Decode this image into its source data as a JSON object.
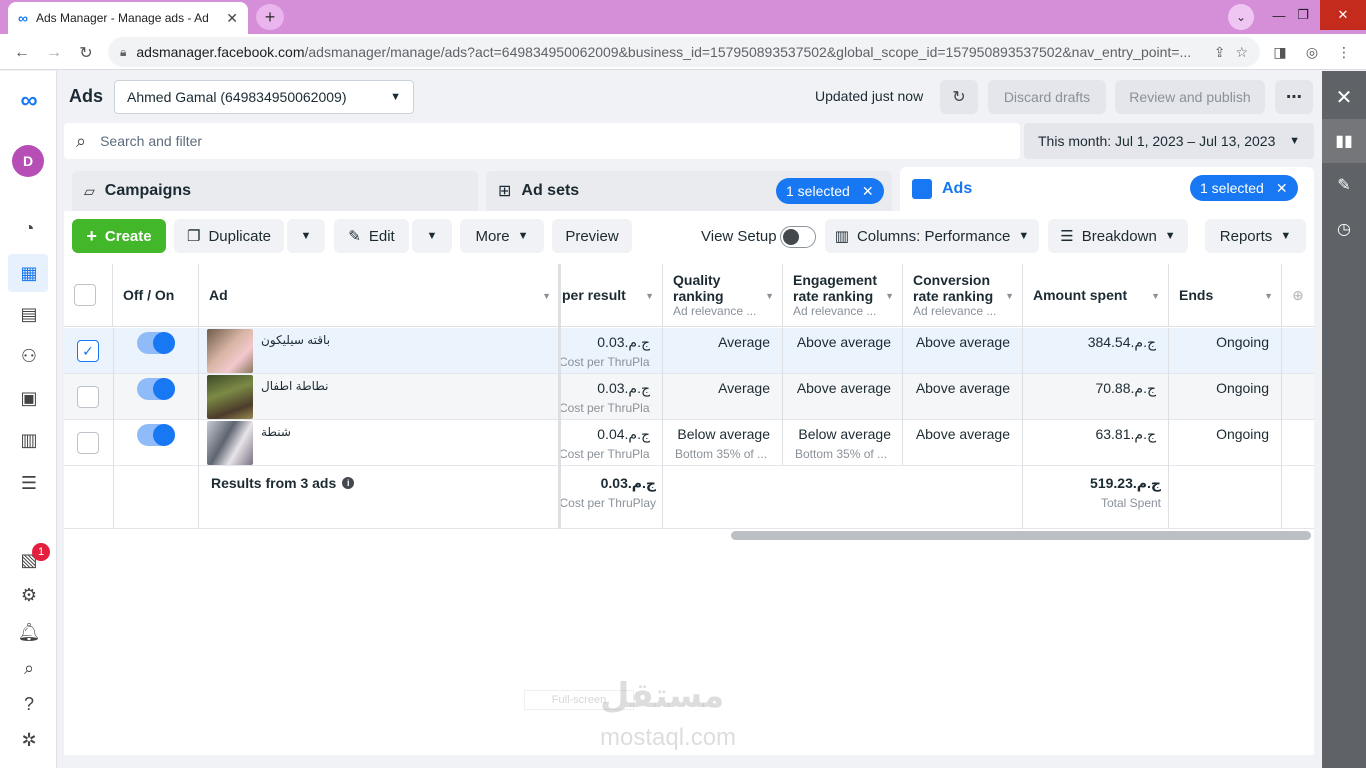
{
  "browser": {
    "tab_title": "Ads Manager - Manage ads - Ad",
    "url_domain": "adsmanager.facebook.com",
    "url_path": "/adsmanager/manage/ads?act=649834950062009&business_id=157950893537502&global_scope_id=157950893537502&nav_entry_point=..."
  },
  "header": {
    "title": "Ads",
    "account": "Ahmed Gamal (649834950062009)",
    "updated": "Updated just now",
    "discard": "Discard drafts",
    "review": "Review and publish"
  },
  "search": {
    "placeholder": "Search and filter"
  },
  "date_range": "This month: Jul 1, 2023 – Jul 13, 2023",
  "levels": {
    "campaigns": "Campaigns",
    "adsets": "Ad sets",
    "ads": "Ads",
    "selected": "1 selected"
  },
  "rail": {
    "avatar": "D",
    "notif_count": "1"
  },
  "toolbar": {
    "create": "Create",
    "duplicate": "Duplicate",
    "edit": "Edit",
    "more": "More",
    "preview": "Preview",
    "view_setup": "View Setup",
    "columns": "Columns: Performance",
    "breakdown": "Breakdown",
    "reports": "Reports"
  },
  "columns": {
    "onoff": "Off / On",
    "ad": "Ad",
    "cost": "per result",
    "quality": "Quality ranking",
    "quality_sub": "Ad relevance ...",
    "engagement": "Engagement rate ranking",
    "engagement_sub": "Ad relevance ...",
    "conversion": "Conversion rate ranking",
    "conversion_sub": "Ad relevance ...",
    "spent": "Amount spent",
    "ends": "Ends"
  },
  "rows": [
    {
      "name": "باقته سيليكون",
      "cost": "ج.م.0.03",
      "cost_sub": "Cost per ThruPlay",
      "quality": "Average",
      "quality_sub": "",
      "engagement": "Above average",
      "engagement_sub": "",
      "conversion": "Above average",
      "spent": "ج.م.384.54",
      "ends": "Ongoing"
    },
    {
      "name": "نطاطة اطفال",
      "cost": "ج.م.0.03",
      "cost_sub": "Cost per ThruPlay",
      "quality": "Average",
      "quality_sub": "",
      "engagement": "Above average",
      "engagement_sub": "",
      "conversion": "Above average",
      "spent": "ج.م.70.88",
      "ends": "Ongoing"
    },
    {
      "name": "شنطة",
      "cost": "ج.م.0.04",
      "cost_sub": "Cost per ThruPlay",
      "quality": "Below average",
      "quality_sub": "Bottom 35% of ...",
      "engagement": "Below average",
      "engagement_sub": "Bottom 35% of ...",
      "conversion": "Above average",
      "spent": "ج.م.63.81",
      "ends": "Ongoing"
    }
  ],
  "summary": {
    "label": "Results from 3 ads",
    "cost": "ج.م.0.03",
    "cost_sub": "Cost per ThruPlay",
    "spent": "ج.م.519.23",
    "spent_sub": "Total Spent"
  },
  "watermark": {
    "ar": "مستقل",
    "en": "mostaql.com",
    "overlay": "Full-screen"
  },
  "colors": {
    "accent": "#1877f2",
    "create": "#42b72a",
    "tabstrip": "#d48fd8"
  }
}
